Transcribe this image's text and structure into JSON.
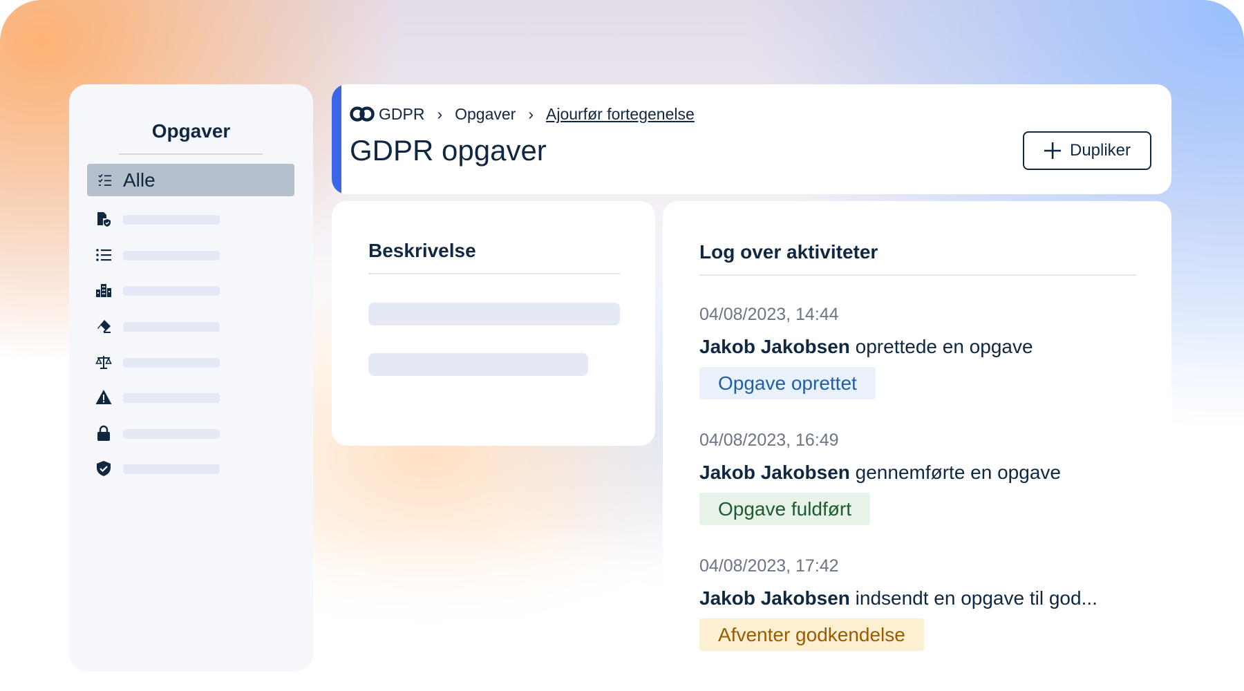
{
  "sidebar": {
    "title": "Opgaver",
    "active_item": {
      "label": "Alle",
      "icon": "checklist-icon"
    },
    "items": [
      {
        "icon": "file-shield-icon"
      },
      {
        "icon": "list-icon"
      },
      {
        "icon": "buildings-icon"
      },
      {
        "icon": "eraser-icon"
      },
      {
        "icon": "scale-icon"
      },
      {
        "icon": "warning-icon"
      },
      {
        "icon": "lock-icon"
      },
      {
        "icon": "shield-check-icon"
      }
    ]
  },
  "header": {
    "breadcrumb": [
      "GDPR",
      "Opgaver",
      "Ajourfør fortegenelse"
    ],
    "title": "GDPR opgaver",
    "duplicate_label": "Dupliker"
  },
  "description": {
    "title": "Beskrivelse"
  },
  "log": {
    "title": "Log over aktiviteter",
    "entries": [
      {
        "timestamp": "04/08/2023, 14:44",
        "user": "Jakob Jakobsen",
        "action": " oprettede en opgave",
        "badge": "Opgave oprettet",
        "badge_bg": "#e9f1fb",
        "badge_color": "#1f5ea8"
      },
      {
        "timestamp": "04/08/2023, 16:49",
        "user": "Jakob Jakobsen",
        "action": " gennemførte en opgave",
        "badge": "Opgave fuldført",
        "badge_bg": "#e7f2e9",
        "badge_color": "#1f5a2e"
      },
      {
        "timestamp": "04/08/2023, 17:42",
        "user": "Jakob Jakobsen",
        "action": " indsendt en opgave til god...",
        "badge": "Afventer godkendelse",
        "badge_bg": "#fcefd2",
        "badge_color": "#9a5a00"
      }
    ]
  },
  "colors": {
    "accent": "#3c66e8",
    "text": "#0f2740"
  }
}
